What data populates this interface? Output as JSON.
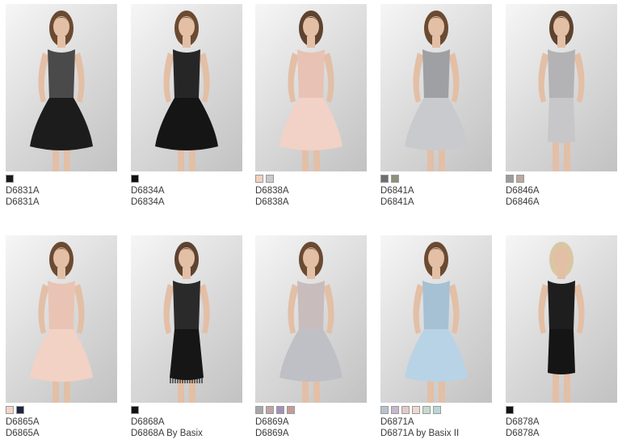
{
  "products": [
    {
      "code": "D6831A",
      "title": "D6831A",
      "swatches": [
        "#1a1a1a"
      ],
      "dress": "#1c1c1c",
      "bodice": "#4a4a4a",
      "hair": "#6b4a32",
      "style": "flare"
    },
    {
      "code": "D6834A",
      "title": "D6834A",
      "swatches": [
        "#101010"
      ],
      "dress": "#151515",
      "bodice": "#262626",
      "hair": "#6b4a32",
      "style": "flare"
    },
    {
      "code": "D6838A",
      "title": "D6838A",
      "swatches": [
        "#f3cfc0",
        "#c9c9cc"
      ],
      "dress": "#f2d2c6",
      "bodice": "#e8c2b4",
      "hair": "#5d4330",
      "style": "flare"
    },
    {
      "code": "D6841A",
      "title": "D6841A",
      "swatches": [
        "#6e6e6e",
        "#8f8f7a"
      ],
      "dress": "#c9cacd",
      "bodice": "#9fa0a4",
      "hair": "#6b4a32",
      "style": "flare"
    },
    {
      "code": "D6846A",
      "title": "D6846A",
      "swatches": [
        "#9c9c9c",
        "#bca8a0"
      ],
      "dress": "#c7c7c9",
      "bodice": "#b3b3b6",
      "hair": "#5d4330",
      "style": "sheath"
    },
    {
      "code": "D6865A",
      "title": "D6865A",
      "swatches": [
        "#f1d6c6",
        "#1e2540"
      ],
      "dress": "#f1d2c4",
      "bodice": "#e9c4b4",
      "hair": "#6b4a32",
      "style": "flare"
    },
    {
      "code": "D6868A",
      "title": "D6868A By Basix",
      "swatches": [
        "#121212"
      ],
      "dress": "#161616",
      "bodice": "#2a2a2a",
      "hair": "#5d4330",
      "style": "fringe"
    },
    {
      "code": "D6869A",
      "title": "D6869A",
      "swatches": [
        "#a8a8aa",
        "#c3a3a6",
        "#a690b8",
        "#c39c97"
      ],
      "dress": "#bfc0c6",
      "bodice": "#c9bcbc",
      "hair": "#6b4a32",
      "style": "flare"
    },
    {
      "code": "D6871A",
      "title": "D6871A by Basix II",
      "swatches": [
        "#b7c2cc",
        "#c9b6cf",
        "#e6c9cc",
        "#efd8cf",
        "#c5dccc",
        "#b9d7d6"
      ],
      "dress": "#b9d3e6",
      "bodice": "#a6c1d4",
      "hair": "#6b4a32",
      "style": "flare"
    },
    {
      "code": "D6878A",
      "title": "D6878A",
      "swatches": [
        "#121212"
      ],
      "dress": "#151515",
      "bodice": "#1e1e1e",
      "hair": "#d9c7a3",
      "style": "sheath"
    }
  ]
}
